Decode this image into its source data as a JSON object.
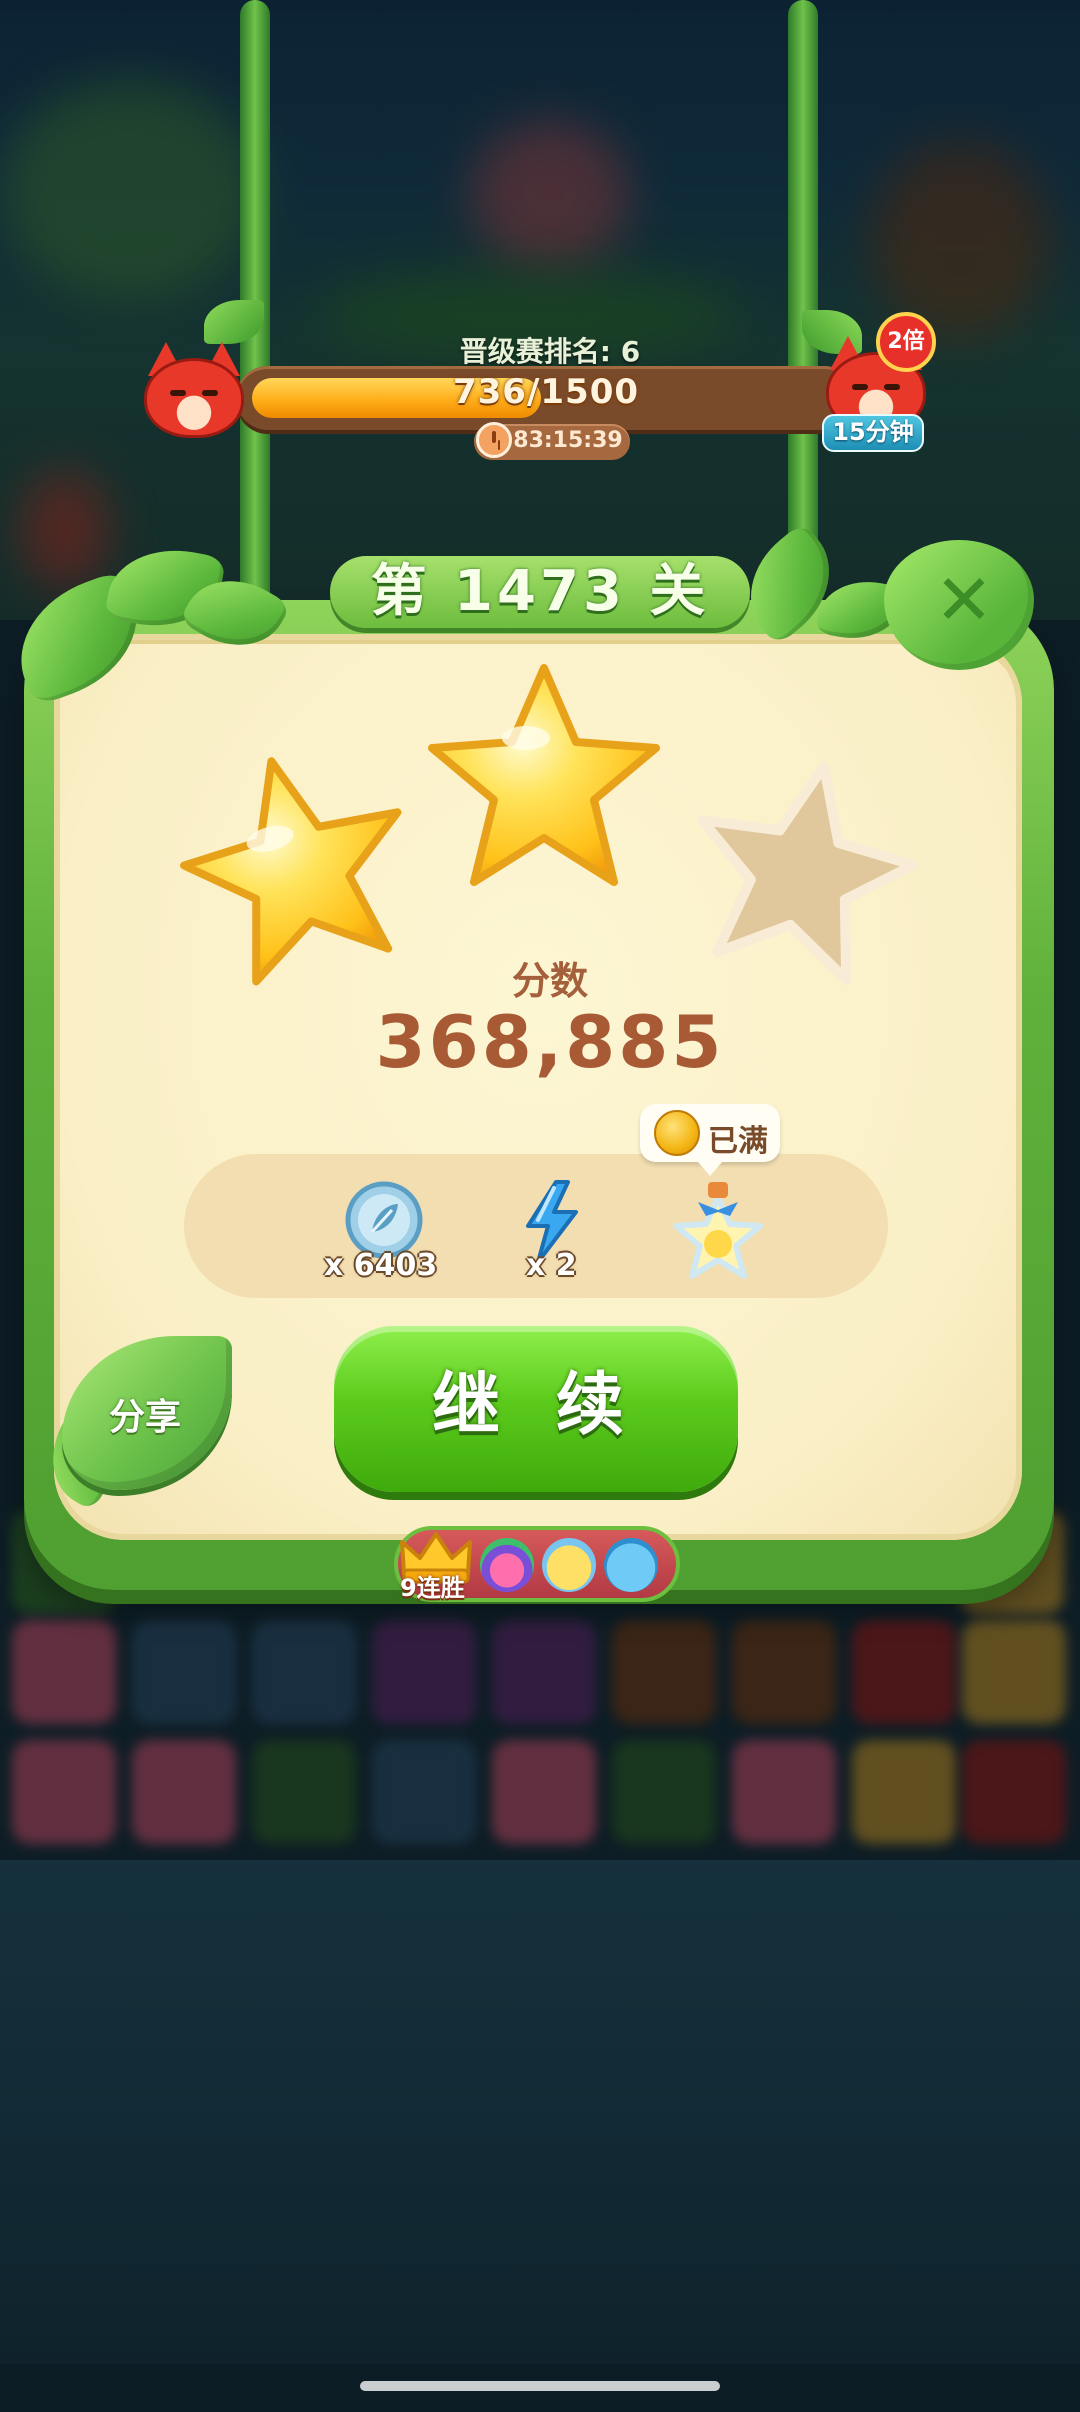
{
  "tournament": {
    "rank_label": "晋级赛排名: 6",
    "progress_text": "736/1500",
    "progress_value": 736,
    "progress_max": 1500,
    "timer": "83:15:39",
    "multiplier": "2倍",
    "bonus_duration": "15分钟"
  },
  "dialog": {
    "title": "第 1473 关",
    "close_symbol": "✕",
    "stars_earned": 2,
    "stars_total": 3,
    "score_label": "分数",
    "score_value": "368,885"
  },
  "rewards": [
    {
      "name": "feather-token",
      "count": "x 6403"
    },
    {
      "name": "lightning-booster",
      "count": "x 2"
    },
    {
      "name": "star-bottle",
      "count": ""
    }
  ],
  "coin_bubble": {
    "text": "已满"
  },
  "buttons": {
    "continue": "继 续",
    "share": "分享"
  },
  "streak": {
    "text": "9连胜",
    "pets": [
      "rainbow-owl-pet",
      "yellow-chick-pet",
      "blue-hippo-pet"
    ]
  },
  "colors": {
    "frame_green": "#5fb13b",
    "panel_cream": "#faefc6",
    "score_brown": "#a85a35",
    "continue_green": "#5ccb1c",
    "progress_orange": "#ffae1a"
  }
}
